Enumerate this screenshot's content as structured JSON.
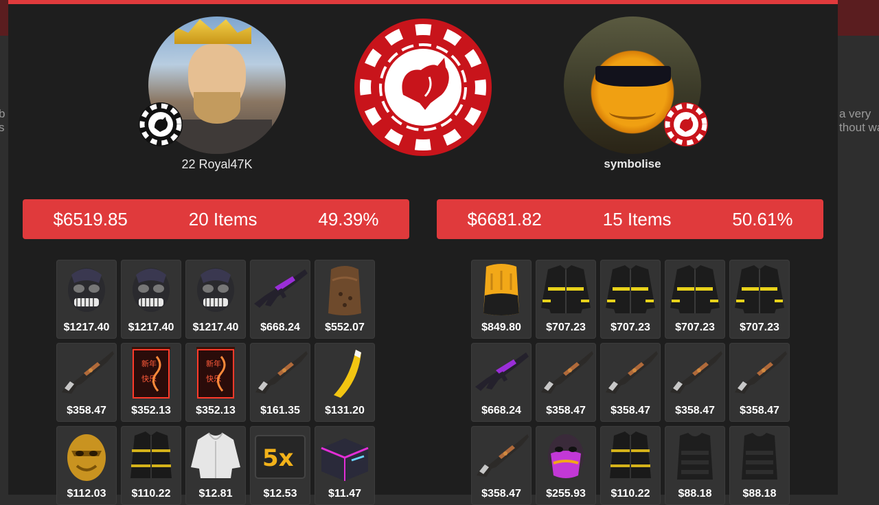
{
  "backdrop": {
    "left_text": [
      "b",
      "s"
    ],
    "right_text": [
      "a very",
      "thout wa"
    ]
  },
  "colors": {
    "accent": "#e03a3c",
    "modal_bg": "#1e1e1e",
    "tile_bg": "#333333",
    "chip_red": "#c8141b"
  },
  "center": {
    "icon": "poker-chip-heart-icon"
  },
  "players": [
    {
      "name": "22 Royal47K",
      "avatar": "king-avatar",
      "badge": "black-chip-badge-icon",
      "total": "$6519.85",
      "items_count": "20 Items",
      "chance": "49.39%",
      "items": [
        {
          "icon": "metal-facemask-icon",
          "price": "$1217.40"
        },
        {
          "icon": "metal-facemask-icon",
          "price": "$1217.40"
        },
        {
          "icon": "metal-facemask-icon",
          "price": "$1217.40"
        },
        {
          "icon": "mp5-purple-icon",
          "price": "$668.24"
        },
        {
          "icon": "burlap-hood-icon",
          "price": "$552.07"
        },
        {
          "icon": "assault-rifle-icon",
          "price": "$358.47"
        },
        {
          "icon": "neon-banner-icon",
          "price": "$352.13"
        },
        {
          "icon": "neon-banner-icon",
          "price": "$352.13"
        },
        {
          "icon": "assault-rifle-icon",
          "price": "$161.35"
        },
        {
          "icon": "banana-weapon-icon",
          "price": "$131.20"
        },
        {
          "icon": "gold-mask-icon",
          "price": "$112.03"
        },
        {
          "icon": "black-jacket-icon",
          "price": "$110.22"
        },
        {
          "icon": "white-hoodie-icon",
          "price": "$12.81"
        },
        {
          "icon": "neon-5x-sign-icon",
          "price": "$12.53"
        },
        {
          "icon": "neon-box-icon",
          "price": "$11.47"
        }
      ]
    },
    {
      "name": "symbolise",
      "avatar": "sunglasses-ball-avatar",
      "badge": "red-chip-badge-icon",
      "total": "$6681.82",
      "items_count": "15 Items",
      "chance": "50.61%",
      "items": [
        {
          "icon": "yellow-hood-icon",
          "price": "$849.80"
        },
        {
          "icon": "firefighter-jacket-icon",
          "price": "$707.23"
        },
        {
          "icon": "firefighter-jacket-icon",
          "price": "$707.23"
        },
        {
          "icon": "firefighter-jacket-icon",
          "price": "$707.23"
        },
        {
          "icon": "firefighter-jacket-icon",
          "price": "$707.23"
        },
        {
          "icon": "mp5-purple-icon",
          "price": "$668.24"
        },
        {
          "icon": "assault-rifle-icon",
          "price": "$358.47"
        },
        {
          "icon": "assault-rifle-icon",
          "price": "$358.47"
        },
        {
          "icon": "assault-rifle-icon",
          "price": "$358.47"
        },
        {
          "icon": "assault-rifle-icon",
          "price": "$358.47"
        },
        {
          "icon": "assault-rifle-icon",
          "price": "$358.47"
        },
        {
          "icon": "purple-facemask-icon",
          "price": "$255.93"
        },
        {
          "icon": "black-jacket-icon",
          "price": "$110.22"
        },
        {
          "icon": "black-vest-icon",
          "price": "$88.18"
        },
        {
          "icon": "black-vest-icon",
          "price": "$88.18"
        }
      ]
    }
  ]
}
